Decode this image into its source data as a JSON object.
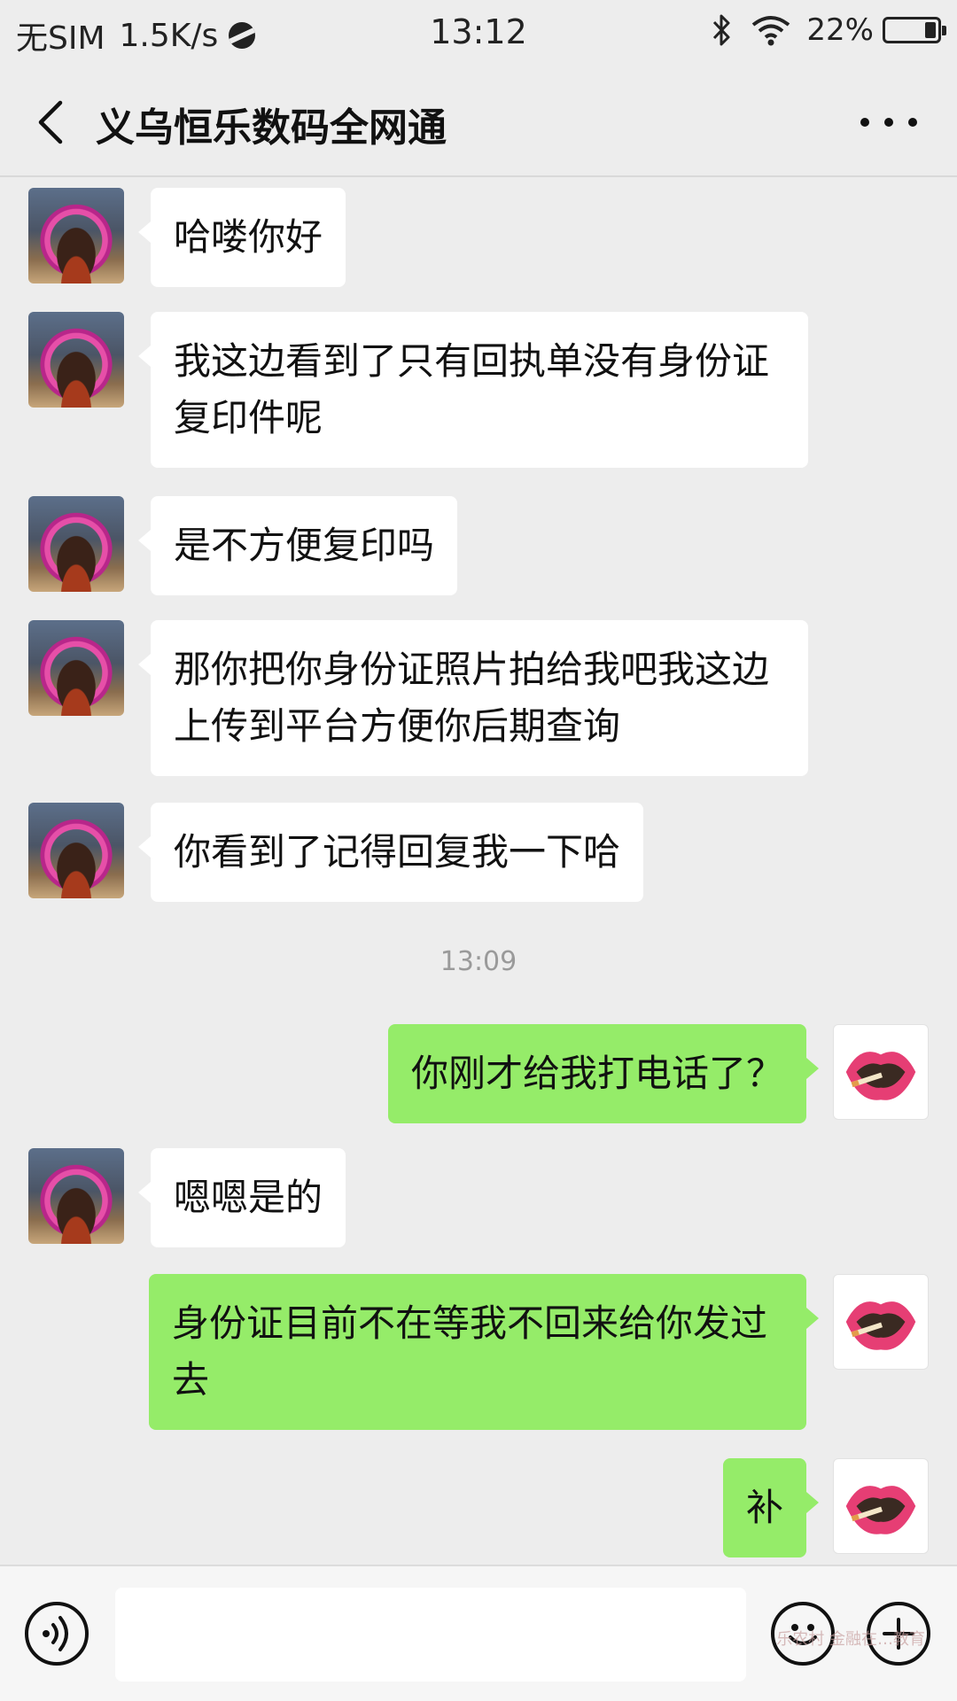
{
  "status_bar": {
    "carrier": "无SIM",
    "net_speed": "1.5K/s",
    "time": "13:12",
    "battery": "22%",
    "battery_level": 0.22
  },
  "header": {
    "title": "义乌恒乐数码全网通",
    "back_icon": "chevron-left-icon",
    "more_icon": "more-dots-icon"
  },
  "messages": [
    {
      "side": "in",
      "text": "哈喽你好"
    },
    {
      "side": "in",
      "text": "我这边看到了只有回执单没有身份证复印件呢"
    },
    {
      "side": "in",
      "text": "是不方便复印吗"
    },
    {
      "side": "in",
      "text": "那你把你身份证照片拍给我吧我这边上传到平台方便你后期查询"
    },
    {
      "side": "in",
      "text": "你看到了记得回复我一下哈"
    },
    {
      "side": "out",
      "text": "你刚才给我打电话了？"
    },
    {
      "side": "in",
      "text": "嗯嗯是的"
    },
    {
      "side": "out",
      "text": "身份证目前不在等我不回来给你发过去"
    },
    {
      "side": "out",
      "text": "补"
    }
  ],
  "timestamp": "13:09",
  "input_bar": {
    "voice_icon": "voice-icon",
    "emoji_icon": "emoji-icon",
    "plus_icon": "plus-icon",
    "placeholder": "",
    "watermark": "乐农村 金融在…教育"
  },
  "colors": {
    "background": "#ededed",
    "incoming_bubble": "#ffffff",
    "outgoing_bubble": "#95ec69"
  }
}
